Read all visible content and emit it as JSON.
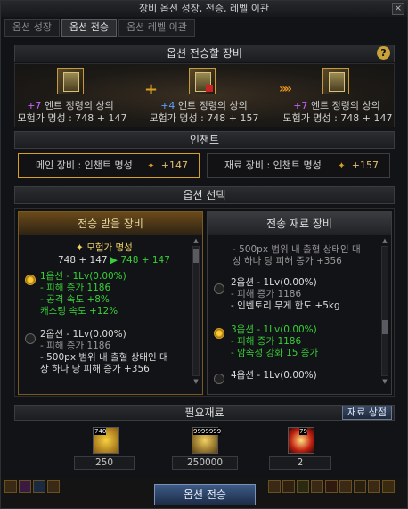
{
  "window": {
    "title": "장비 옵션 성장, 전승, 레벨 이관",
    "close": "×"
  },
  "tabs": [
    {
      "label": "옵션 성장",
      "active": false
    },
    {
      "label": "옵션 전승",
      "active": true
    },
    {
      "label": "옵션 레벨 이관",
      "active": false
    }
  ],
  "transfer": {
    "header": "옵션 전승할 장비",
    "help": "?",
    "plus_sign": "+",
    "arrow": "»»",
    "items": [
      {
        "plus": "+7",
        "name": "엔트 정령의 상의",
        "fame": "모험가 명성 : 748 + 147",
        "plus_color": "#c864ff"
      },
      {
        "plus": "+4",
        "name": "엔트 정령의 상의",
        "fame": "모험가 명성 : 748 + 157",
        "plus_color": "#5aa0ff"
      },
      {
        "plus": "+7",
        "name": "엔트 정령의 상의",
        "fame": "모험가 명성 : 748 + 147",
        "plus_color": "#c864ff"
      }
    ]
  },
  "enchant": {
    "header": "인챈트",
    "main": {
      "label": "메인 장비 : 인챈트 명성",
      "value": "+147"
    },
    "material": {
      "label": "재료 장비 : 인챈트 명성",
      "value": "+157"
    }
  },
  "option_select": {
    "header": "옵션 선택",
    "left": {
      "title": "전승 받을 장비",
      "fame_label": "모험가 명성",
      "fame_line_from": "748 + 147",
      "fame_arrow": "▶",
      "fame_line_to": "748 + 147",
      "options": [
        {
          "title": "1옵션 - 1Lv(0.00%)",
          "selected": true,
          "lines": [
            "- 피해 증가 1186",
            "- 공격 속도 +8%",
            "  캐스팅 속도 +12%"
          ]
        },
        {
          "title": "2옵션 - 1Lv(0.00%)",
          "selected": false,
          "lines": [
            "- 피해 증가 1186",
            "- 500px 범위 내 출혈 상태인 대",
            "  상 하나 당 피해 증가 +356"
          ]
        }
      ]
    },
    "right": {
      "title": "전송 재료 장비",
      "top_lines": [
        "- 500px 범위 내 출혈 상태인 대",
        "  상 하나 당 피해 증가 +356"
      ],
      "options": [
        {
          "title": "2옵션 - 1Lv(0.00%)",
          "selected": false,
          "lines": [
            "- 피해 증가 1186",
            "- 인벤토리 무게 한도 +5kg"
          ]
        },
        {
          "title": "3옵션 - 1Lv(0.00%)",
          "selected": true,
          "lines": [
            "- 피해 증가 1186",
            "- 암속성 강화 15 증가"
          ]
        },
        {
          "title": "4옵션 - 1Lv(0.00%)",
          "selected": false,
          "lines": []
        }
      ]
    }
  },
  "materials": {
    "header": "필요재료",
    "shop_button": "재료 상점",
    "items": [
      {
        "icon": "gold-crystal-icon",
        "badge": "740",
        "amount": "250"
      },
      {
        "icon": "gold-coins-icon",
        "badge": "9999999",
        "amount": "250000"
      },
      {
        "icon": "fire-orb-icon",
        "badge": "79",
        "amount": "2"
      }
    ]
  },
  "action": {
    "label": "옵션 전승"
  }
}
